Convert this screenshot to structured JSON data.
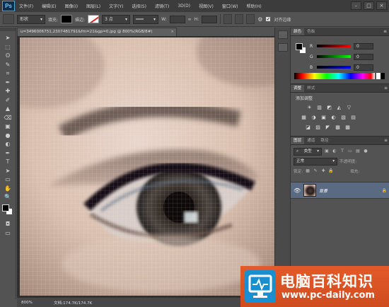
{
  "app": {
    "logo_text": "Ps"
  },
  "menu": {
    "items": [
      "文件(F)",
      "编辑(E)",
      "图像(I)",
      "图层(L)",
      "文字(Y)",
      "选择(S)",
      "滤镜(T)",
      "3D(D)",
      "视图(V)",
      "窗口(W)",
      "帮助(H)"
    ],
    "window_controls": [
      "–",
      "□",
      "×"
    ]
  },
  "options_bar": {
    "mode_select": "形状",
    "fill_label": "填充:",
    "stroke_label": "描边:",
    "stroke_size": "3 点",
    "width_label": "W:",
    "height_label": "H:",
    "align_edges_label": "对齐边缘"
  },
  "document": {
    "tab_title": "u=3496006751,2307481791&fm=21&gp=0.jpg @ 800%(RGB/8#)",
    "close_glyph": "×",
    "zoom": "800%",
    "doc_info": "文档:174.7K/174.7K"
  },
  "color_panel": {
    "tabs": [
      "颜色",
      "色板"
    ],
    "channels": [
      {
        "label": "R",
        "value": "0",
        "gradient": "linear-gradient(90deg,#000,#f00)"
      },
      {
        "label": "G",
        "value": "0",
        "gradient": "linear-gradient(90deg,#000,#0f0)"
      },
      {
        "label": "B",
        "value": "0",
        "gradient": "linear-gradient(90deg,#000,#00f)"
      }
    ]
  },
  "adjustments_panel": {
    "tabs": [
      "调整",
      "样式"
    ],
    "title": "添加调整",
    "row1": [
      "☀",
      "▥",
      "◩",
      "◭",
      "▽"
    ],
    "row2": [
      "▦",
      "◑",
      "▣",
      "◐",
      "▧",
      "▤"
    ],
    "row3": [
      "◪",
      "▨",
      "◤",
      "▩",
      "▩"
    ]
  },
  "layers_panel": {
    "tabs": [
      "图层",
      "通道",
      "路径"
    ],
    "filter_select": "类型",
    "blend_mode": "正常",
    "opacity_label": "不透明度:",
    "lock_label": "锁定:",
    "fill_label": "填充:",
    "layer": {
      "name": "背景",
      "visible_glyph": "👁",
      "lock_glyph": "🔒"
    }
  },
  "tools": [
    "➤",
    "⬚",
    "ʘ",
    "✎",
    "⌗",
    "✒",
    "✚",
    "✐",
    "▲",
    "⌫",
    "▣",
    "●",
    "◐",
    "✒",
    "T",
    "➤",
    "▭",
    "✋",
    "🔍"
  ],
  "watermark": {
    "title": "电脑百科知识",
    "url": "www.pc-daily.com"
  }
}
